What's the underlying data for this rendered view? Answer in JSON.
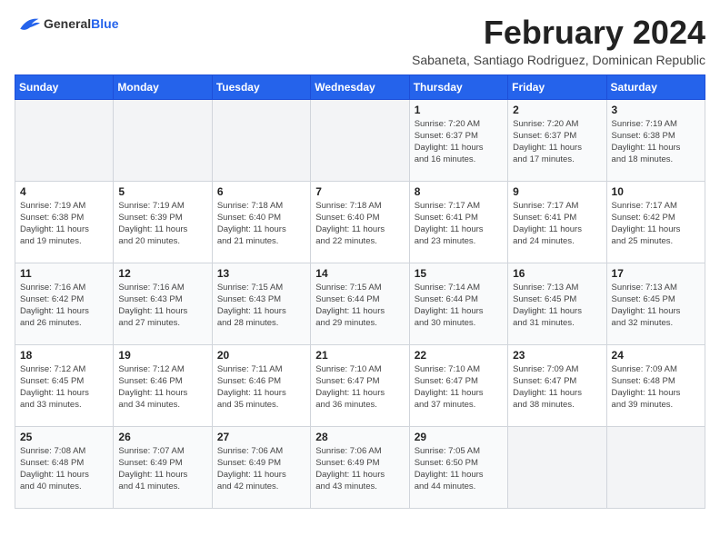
{
  "logo": {
    "general": "General",
    "blue": "Blue"
  },
  "title": "February 2024",
  "subtitle": "Sabaneta, Santiago Rodriguez, Dominican Republic",
  "days_of_week": [
    "Sunday",
    "Monday",
    "Tuesday",
    "Wednesday",
    "Thursday",
    "Friday",
    "Saturday"
  ],
  "weeks": [
    [
      {
        "day": "",
        "info": ""
      },
      {
        "day": "",
        "info": ""
      },
      {
        "day": "",
        "info": ""
      },
      {
        "day": "",
        "info": ""
      },
      {
        "day": "1",
        "info": "Sunrise: 7:20 AM\nSunset: 6:37 PM\nDaylight: 11 hours\nand 16 minutes."
      },
      {
        "day": "2",
        "info": "Sunrise: 7:20 AM\nSunset: 6:37 PM\nDaylight: 11 hours\nand 17 minutes."
      },
      {
        "day": "3",
        "info": "Sunrise: 7:19 AM\nSunset: 6:38 PM\nDaylight: 11 hours\nand 18 minutes."
      }
    ],
    [
      {
        "day": "4",
        "info": "Sunrise: 7:19 AM\nSunset: 6:38 PM\nDaylight: 11 hours\nand 19 minutes."
      },
      {
        "day": "5",
        "info": "Sunrise: 7:19 AM\nSunset: 6:39 PM\nDaylight: 11 hours\nand 20 minutes."
      },
      {
        "day": "6",
        "info": "Sunrise: 7:18 AM\nSunset: 6:40 PM\nDaylight: 11 hours\nand 21 minutes."
      },
      {
        "day": "7",
        "info": "Sunrise: 7:18 AM\nSunset: 6:40 PM\nDaylight: 11 hours\nand 22 minutes."
      },
      {
        "day": "8",
        "info": "Sunrise: 7:17 AM\nSunset: 6:41 PM\nDaylight: 11 hours\nand 23 minutes."
      },
      {
        "day": "9",
        "info": "Sunrise: 7:17 AM\nSunset: 6:41 PM\nDaylight: 11 hours\nand 24 minutes."
      },
      {
        "day": "10",
        "info": "Sunrise: 7:17 AM\nSunset: 6:42 PM\nDaylight: 11 hours\nand 25 minutes."
      }
    ],
    [
      {
        "day": "11",
        "info": "Sunrise: 7:16 AM\nSunset: 6:42 PM\nDaylight: 11 hours\nand 26 minutes."
      },
      {
        "day": "12",
        "info": "Sunrise: 7:16 AM\nSunset: 6:43 PM\nDaylight: 11 hours\nand 27 minutes."
      },
      {
        "day": "13",
        "info": "Sunrise: 7:15 AM\nSunset: 6:43 PM\nDaylight: 11 hours\nand 28 minutes."
      },
      {
        "day": "14",
        "info": "Sunrise: 7:15 AM\nSunset: 6:44 PM\nDaylight: 11 hours\nand 29 minutes."
      },
      {
        "day": "15",
        "info": "Sunrise: 7:14 AM\nSunset: 6:44 PM\nDaylight: 11 hours\nand 30 minutes."
      },
      {
        "day": "16",
        "info": "Sunrise: 7:13 AM\nSunset: 6:45 PM\nDaylight: 11 hours\nand 31 minutes."
      },
      {
        "day": "17",
        "info": "Sunrise: 7:13 AM\nSunset: 6:45 PM\nDaylight: 11 hours\nand 32 minutes."
      }
    ],
    [
      {
        "day": "18",
        "info": "Sunrise: 7:12 AM\nSunset: 6:45 PM\nDaylight: 11 hours\nand 33 minutes."
      },
      {
        "day": "19",
        "info": "Sunrise: 7:12 AM\nSunset: 6:46 PM\nDaylight: 11 hours\nand 34 minutes."
      },
      {
        "day": "20",
        "info": "Sunrise: 7:11 AM\nSunset: 6:46 PM\nDaylight: 11 hours\nand 35 minutes."
      },
      {
        "day": "21",
        "info": "Sunrise: 7:10 AM\nSunset: 6:47 PM\nDaylight: 11 hours\nand 36 minutes."
      },
      {
        "day": "22",
        "info": "Sunrise: 7:10 AM\nSunset: 6:47 PM\nDaylight: 11 hours\nand 37 minutes."
      },
      {
        "day": "23",
        "info": "Sunrise: 7:09 AM\nSunset: 6:47 PM\nDaylight: 11 hours\nand 38 minutes."
      },
      {
        "day": "24",
        "info": "Sunrise: 7:09 AM\nSunset: 6:48 PM\nDaylight: 11 hours\nand 39 minutes."
      }
    ],
    [
      {
        "day": "25",
        "info": "Sunrise: 7:08 AM\nSunset: 6:48 PM\nDaylight: 11 hours\nand 40 minutes."
      },
      {
        "day": "26",
        "info": "Sunrise: 7:07 AM\nSunset: 6:49 PM\nDaylight: 11 hours\nand 41 minutes."
      },
      {
        "day": "27",
        "info": "Sunrise: 7:06 AM\nSunset: 6:49 PM\nDaylight: 11 hours\nand 42 minutes."
      },
      {
        "day": "28",
        "info": "Sunrise: 7:06 AM\nSunset: 6:49 PM\nDaylight: 11 hours\nand 43 minutes."
      },
      {
        "day": "29",
        "info": "Sunrise: 7:05 AM\nSunset: 6:50 PM\nDaylight: 11 hours\nand 44 minutes."
      },
      {
        "day": "",
        "info": ""
      },
      {
        "day": "",
        "info": ""
      }
    ]
  ]
}
